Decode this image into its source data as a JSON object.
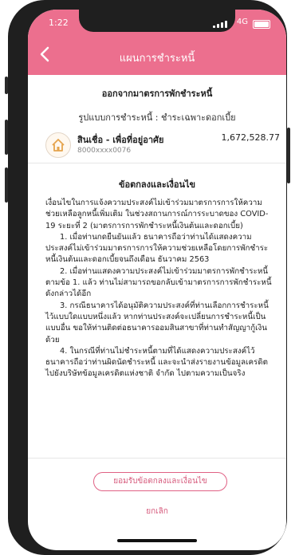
{
  "status_bar": {
    "time": "1:22",
    "network": "4G"
  },
  "nav": {
    "title": "แผนการชำระหนี้"
  },
  "section": {
    "title": "ออกจากมาตรการพักชำระหนี้",
    "payment_type": "รูปแบบการชำระหนี้ : ชำระเฉพาะดอกเบี้ย"
  },
  "account": {
    "icon": "home-icon",
    "name": "สินเชื่อ - เพื่อที่อยู่อาศัย",
    "number": "8000xxxx0076",
    "amount": "1,672,528.77"
  },
  "terms": {
    "title": "ข้อตกลงและเงื่อนไข",
    "paragraphs": [
      "เงื่อนไขในการแจ้งความประสงค์ไม่เข้าร่วมมาตรการการให้ความช่วยเหลือลูกหนี้เพิ่มเติม ในช่วงสถานการณ์การระบาดของ COVID-19 ระยะที่ 2 (มาตรการการพักชำระหนี้เงินต้นและดอกเบี้ย)",
      "1. เมื่อท่านกดยืนยันแล้ว ธนาคารถือว่าท่านได้แสดงความประสงค์ไม่เข้าร่วมมาตรการการให้ความช่วยเหลือโดยการพักชำระหนี้เงินต้นและดอกเบี้ยจนถึงเดือน ธันวาคม 2563",
      "2. เมื่อท่านแสดงความประสงค์ไม่เข้าร่วมมาตรการพักชำระหนี้ตามข้อ 1. แล้ว ท่านไม่สามารถขอกลับเข้ามาตรการการพักชำระหนี้ดังกล่าวได้อีก",
      "3. กรณีธนาคารได้อนุมัติความประสงค์ที่ท่านเลือกการชำระหนี้ไว้แบบใดแบบหนึ่งแล้ว หากท่านประสงค์จะเปลี่ยนการชำระหนี้เป็นแบบอื่น ขอให้ท่านติดต่อธนาคารออมสินสาขาที่ท่านทำสัญญากู้เงินด้วย",
      "4. ในกรณีที่ท่านไม่ชำระหนี้ตามที่ได้แสดงความประสงค์ไว้ ธนาคารถือว่าท่านผิดนัดชำระหนี้ และจะนำส่งรายงานข้อมูลเครดิตไปยังบริษัทข้อมูลเครดิตแห่งชาติ จำกัด ไปตามความเป็นจริง"
    ]
  },
  "actions": {
    "accept": "ยอมรับข้อตกลงและเงื่อนไข",
    "cancel": "ยกเลิก"
  }
}
